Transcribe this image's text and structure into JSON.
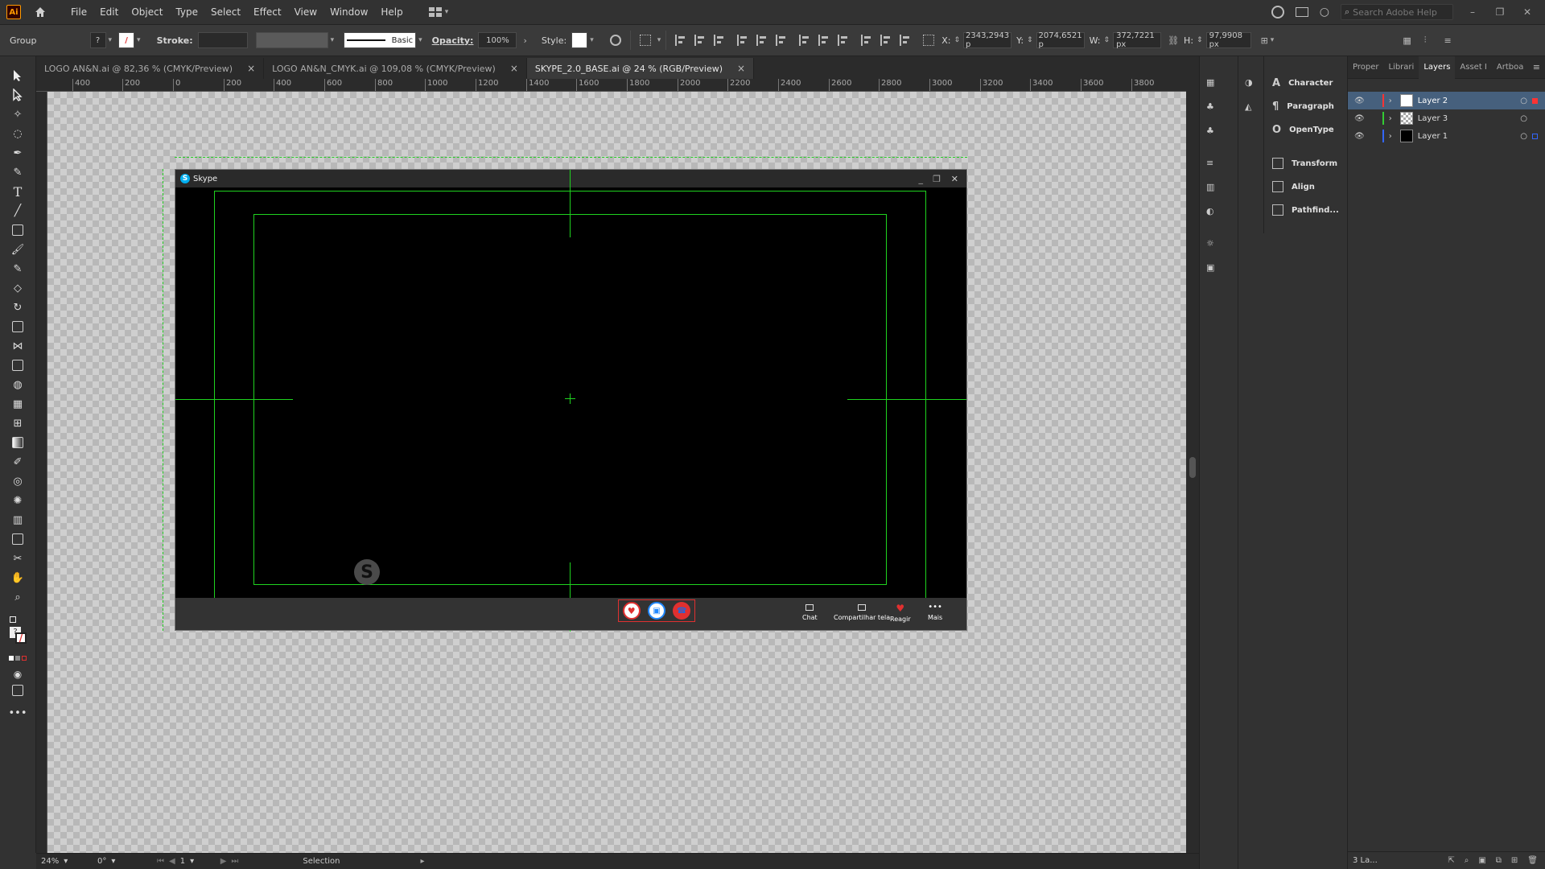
{
  "app": {
    "logo": "Ai",
    "accent": "#ff9a00"
  },
  "menu": [
    "File",
    "Edit",
    "Object",
    "Type",
    "Select",
    "Effect",
    "View",
    "Window",
    "Help"
  ],
  "search": {
    "placeholder": "Search Adobe Help"
  },
  "control_bar": {
    "selection_type": "Group",
    "stroke_label": "Stroke:",
    "brush": "Basic",
    "opacity_label": "Opacity:",
    "opacity_value": "100%",
    "style_label": "Style:",
    "x_label": "X:",
    "x_value": "2343,2943 p",
    "y_label": "Y:",
    "y_value": "2074,6521 p",
    "w_label": "W:",
    "w_value": "372,7221 px",
    "h_label": "H:",
    "h_value": "97,9908 px"
  },
  "tabs": [
    {
      "label": "LOGO AN&N.ai @ 82,36 % (CMYK/Preview)",
      "active": false
    },
    {
      "label": "LOGO AN&N_CMYK.ai @ 109,08 % (CMYK/Preview)",
      "active": false
    },
    {
      "label": "SKYPE_2.0_BASE.ai @ 24 % (RGB/Preview)",
      "active": true
    }
  ],
  "ruler_h": [
    "400",
    "200",
    "0",
    "200",
    "400",
    "600",
    "800",
    "1000",
    "1200",
    "1400",
    "1600",
    "1800",
    "2000",
    "2200",
    "2400",
    "2600",
    "2800",
    "3000",
    "3200",
    "3400",
    "3600",
    "3800"
  ],
  "status": {
    "zoom": "24%",
    "rotation": "0°",
    "artboard": "1",
    "tool": "Selection"
  },
  "skype": {
    "title": "Skype",
    "controls": [
      {
        "label": "Chat",
        "icon": "chat-icon"
      },
      {
        "label": "Compartilhar tela",
        "icon": "share-screen-icon"
      },
      {
        "label": "Reagir",
        "icon": "heart-icon"
      },
      {
        "label": "Mais",
        "icon": "more-icon"
      }
    ],
    "call_buttons": [
      "mic-icon",
      "video-icon",
      "end-call-icon"
    ]
  },
  "panels": {
    "collapsed": [
      "Character",
      "Paragraph",
      "OpenType",
      "Transform",
      "Align",
      "Pathfind..."
    ],
    "layers_tabs": [
      "Proper",
      "Librari",
      "Layers",
      "Asset I",
      "Artboa"
    ],
    "layers": [
      {
        "name": "Layer 2",
        "color": "#ff3333",
        "selected": true
      },
      {
        "name": "Layer 3",
        "color": "#33cc33",
        "selected": false
      },
      {
        "name": "Layer 1",
        "color": "#3366ff",
        "selected": false
      }
    ],
    "layers_count": "3 La..."
  }
}
